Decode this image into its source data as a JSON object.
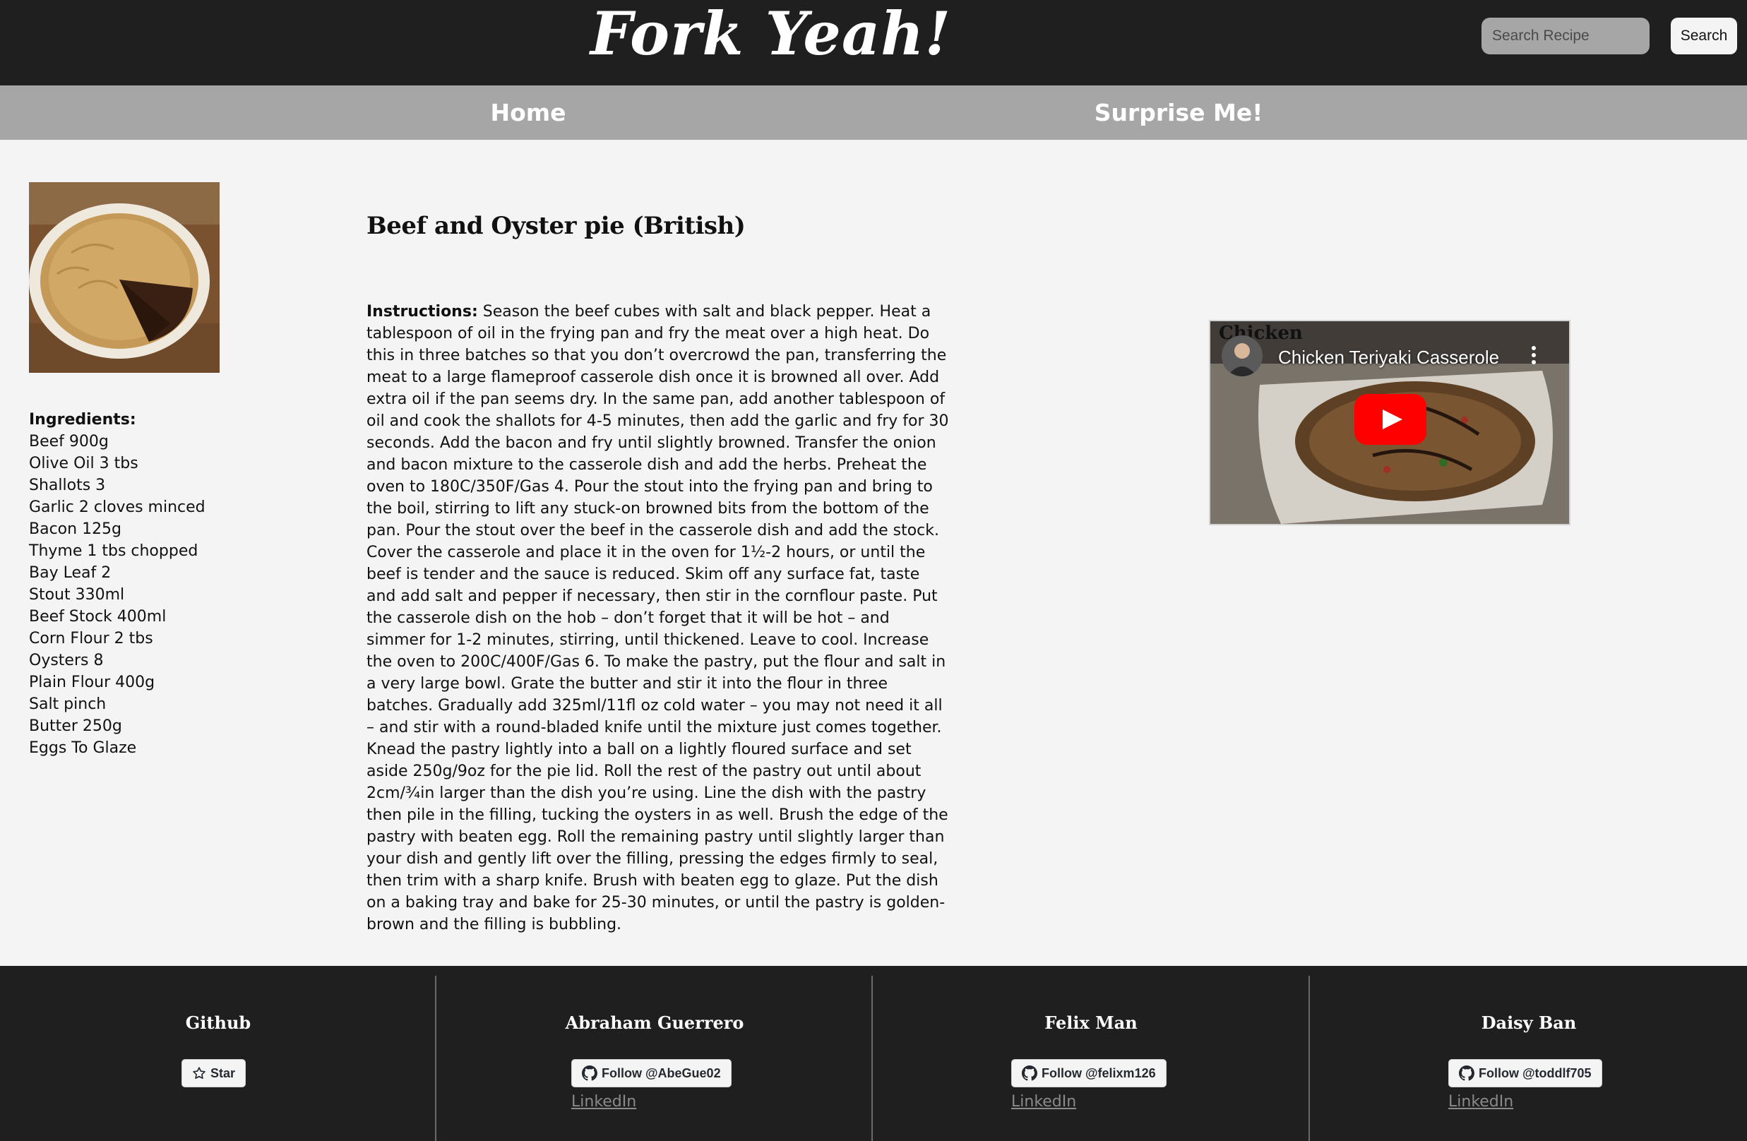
{
  "header": {
    "logo": "Fork Yeah!",
    "search": {
      "placeholder": "Search Recipe",
      "value": "",
      "button_label": "Search"
    }
  },
  "nav": {
    "items": [
      {
        "label": "Home"
      },
      {
        "label": "Surprise Me!"
      }
    ]
  },
  "recipe": {
    "title": "Beef and Oyster pie (British)",
    "ingredients_label": "Ingredients:",
    "ingredients": [
      "Beef 900g",
      "Olive Oil 3 tbs",
      "Shallots 3",
      "Garlic 2 cloves minced",
      "Bacon 125g",
      "Thyme 1 tbs chopped",
      "Bay Leaf 2",
      "Stout 330ml",
      "Beef Stock 400ml",
      "Corn Flour 2 tbs",
      "Oysters 8",
      "Plain Flour 400g",
      "Salt pinch",
      "Butter 250g",
      "Eggs To Glaze"
    ],
    "instructions_label": "Instructions:",
    "instructions": "Season the beef cubes with salt and black pepper. Heat a tablespoon of oil in the frying pan and fry the meat over a high heat. Do this in three batches so that you don’t overcrowd the pan, transferring the meat to a large flameproof casserole dish once it is browned all over. Add extra oil if the pan seems dry. In the same pan, add another tablespoon of oil and cook the shallots for 4-5 minutes, then add the garlic and fry for 30 seconds. Add the bacon and fry until slightly browned. Transfer the onion and bacon mixture to the casserole dish and add the herbs. Preheat the oven to 180C/350F/Gas 4. Pour the stout into the frying pan and bring to the boil, stirring to lift any stuck-on browned bits from the bottom of the pan. Pour the stout over the beef in the casserole dish and add the stock. Cover the casserole and place it in the oven for 1½-2 hours, or until the beef is tender and the sauce is reduced. Skim off any surface fat, taste and add salt and pepper if necessary, then stir in the cornflour paste. Put the casserole dish on the hob – don’t forget that it will be hot – and simmer for 1-2 minutes, stirring, until thickened. Leave to cool. Increase the oven to 200C/400F/Gas 6. To make the pastry, put the flour and salt in a very large bowl. Grate the butter and stir it into the flour in three batches. Gradually add 325ml/11fl oz cold water – you may not need it all – and stir with a round-bladed knife until the mixture just comes together. Knead the pastry lightly into a ball on a lightly floured surface and set aside 250g/9oz for the pie lid. Roll the rest of the pastry out until about 2cm/¾in larger than the dish you’re using. Line the dish with the pastry then pile in the filling, tucking the oysters in as well. Brush the edge of the pastry with beaten egg. Roll the remaining pastry until slightly larger than your dish and gently lift over the filling, pressing the edges firmly to seal, then trim with a sharp knife. Brush with beaten egg to glaze. Put the dish on a baking tray and bake for 25-30 minutes, or until the pastry is golden-brown and the filling is bubbling."
  },
  "video": {
    "title": "Chicken Teriyaki Casserole",
    "overlay_text": "Chicken"
  },
  "footer": {
    "columns": [
      {
        "title": "Github",
        "button": "Star",
        "button_icon": "star-icon"
      },
      {
        "title": "Abraham Guerrero",
        "button": "Follow @AbeGue02",
        "button_icon": "github-icon",
        "link": "LinkedIn"
      },
      {
        "title": "Felix Man",
        "button": "Follow @felixm126",
        "button_icon": "github-icon",
        "link": "LinkedIn"
      },
      {
        "title": "Daisy Ban",
        "button": "Follow @toddlf705",
        "button_icon": "github-icon",
        "link": "LinkedIn"
      }
    ]
  },
  "colors": {
    "header_bg": "#1f1f1f",
    "nav_bg": "#a6a6a6",
    "page_bg": "#f4f4f4",
    "play_red": "#ff0000"
  }
}
